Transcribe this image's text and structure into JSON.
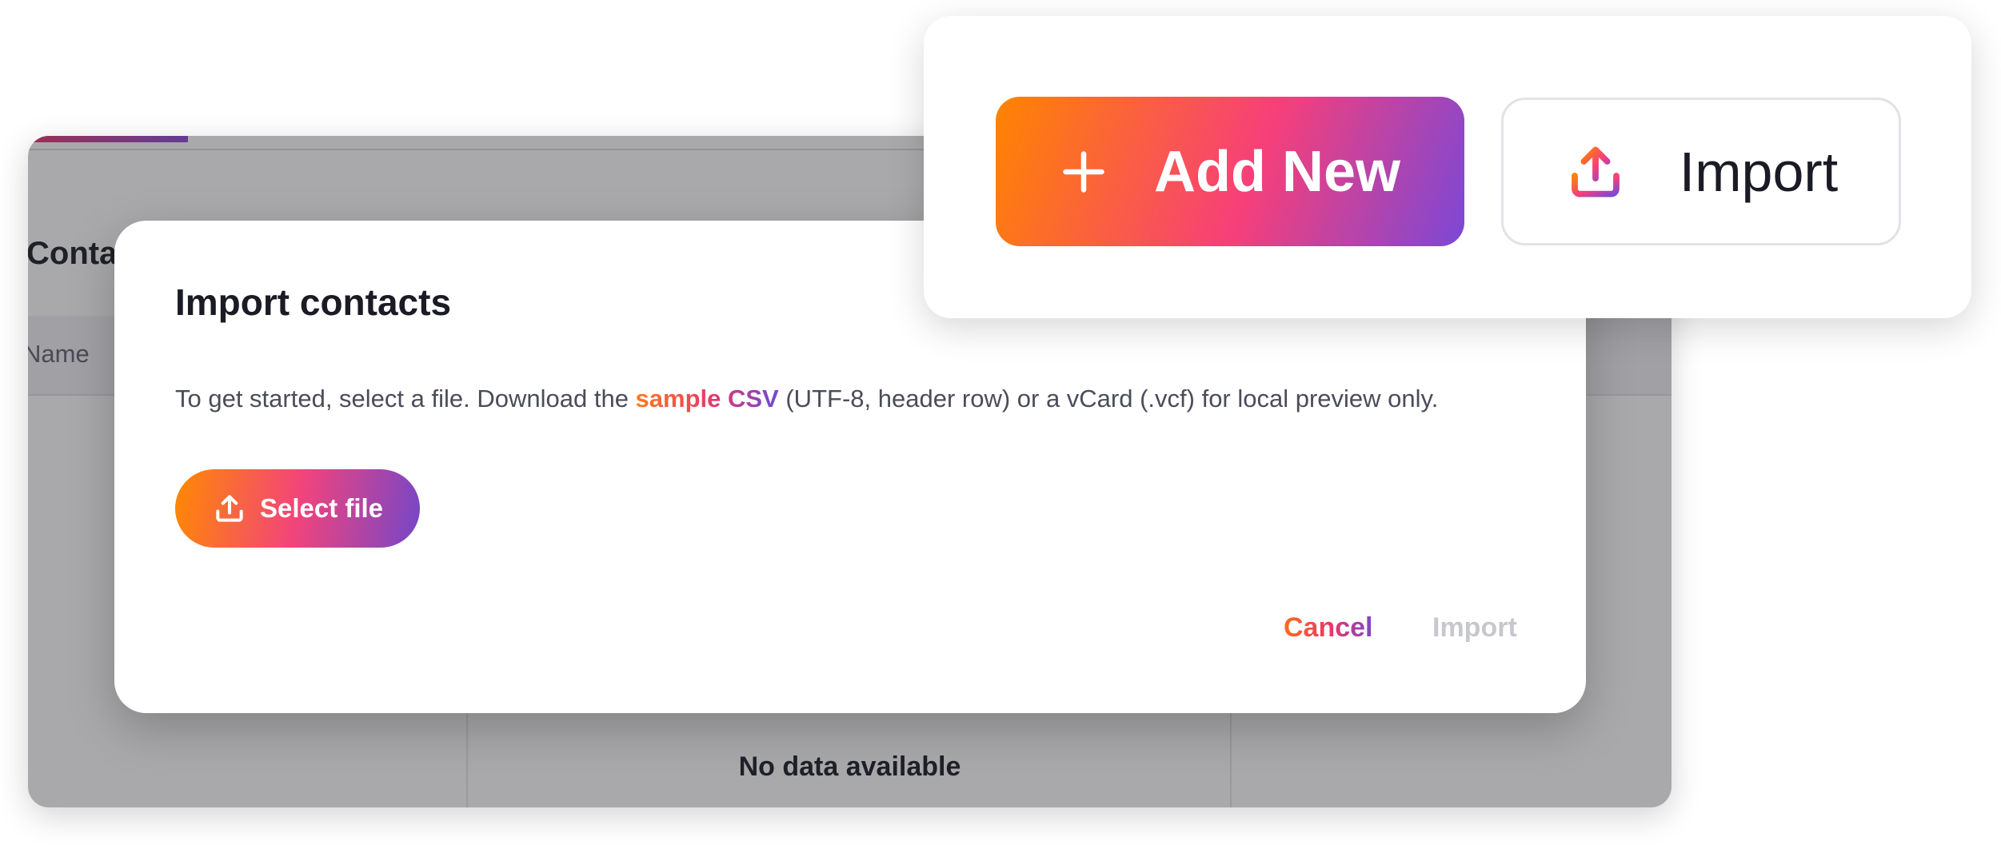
{
  "background": {
    "heading": "Contacts",
    "table_header_name": "Name",
    "empty_state": "No data available"
  },
  "modal": {
    "title": "Import contacts",
    "description_before": "To get started, select a file. Download the ",
    "description_link": "sample CSV",
    "description_after": " (UTF-8, header row) or a vCard (.vcf) for local preview only.",
    "select_file_label": "Select file",
    "cancel_label": "Cancel",
    "import_label": "Import"
  },
  "callout": {
    "add_new_label": "Add New",
    "import_label": "Import"
  },
  "colors": {
    "gradient_start": "#ff8400",
    "gradient_mid": "#f63f7a",
    "gradient_end": "#7b48d6",
    "disabled_text": "#c7c8cf"
  },
  "icons": {
    "select_file": "upload-icon",
    "add_new": "plus-icon",
    "import": "upload-icon"
  }
}
